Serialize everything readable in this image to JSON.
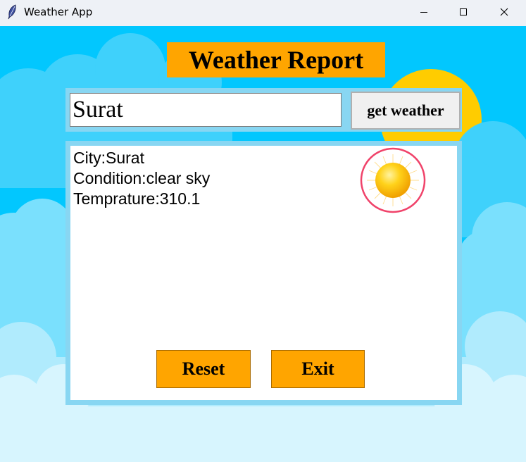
{
  "window": {
    "title": "Weather App",
    "icons": [
      "feather-icon",
      "minimize-icon",
      "maximize-icon",
      "close-icon"
    ]
  },
  "app": {
    "heading": "Weather Report",
    "city_input_value": "Surat",
    "get_weather_label": "get weather",
    "result": {
      "city_line": "City:Surat",
      "condition_line": "Condition:clear sky",
      "temperature_line": "Temprature:310.1"
    },
    "condition_icon": "sun-icon",
    "reset_label": "Reset",
    "exit_label": "Exit"
  },
  "colors": {
    "sky": "#02c7fe",
    "accent": "#ffa500",
    "frame": "#88d6f2",
    "sun": "#ffcc00"
  }
}
